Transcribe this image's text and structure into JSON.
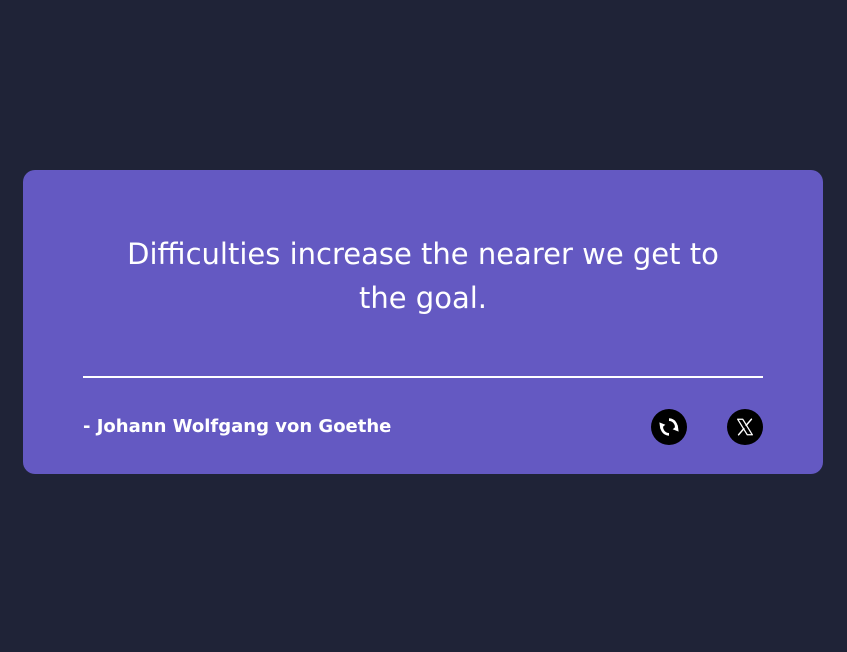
{
  "quote": {
    "text": "Difficulties increase the nearer we get to the goal.",
    "author": "- Johann Wolfgang von Goethe"
  },
  "actions": {
    "refresh_icon": "refresh-icon",
    "share_icon": "x-logo-icon"
  },
  "colors": {
    "background": "#1f2337",
    "card": "#6459c2",
    "text": "#ffffff",
    "button": "#000000"
  }
}
